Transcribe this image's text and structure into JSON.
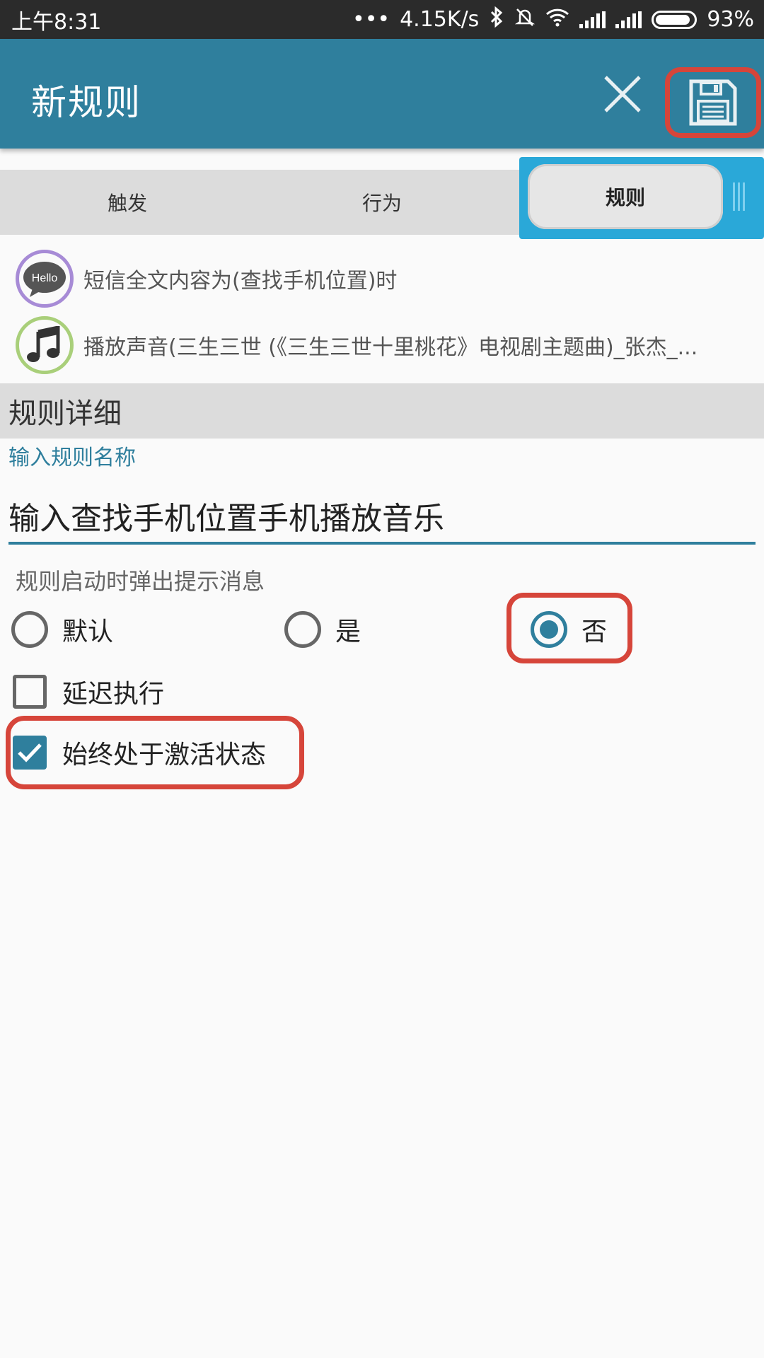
{
  "status_bar": {
    "time": "上午8:31",
    "dots": "•••",
    "speed": "4.15K/s",
    "battery": "93%",
    "bluetooth_icon": "bluetooth-icon",
    "mute_icon": "bell-off-icon",
    "wifi_icon": "wifi-icon"
  },
  "app_bar": {
    "title": "新规则",
    "close_icon": "close-icon",
    "save_icon": "floppy-save-icon"
  },
  "tabs": [
    {
      "label": "触发"
    },
    {
      "label": "行为"
    },
    {
      "label": "规则",
      "active": true
    }
  ],
  "summary": [
    {
      "icon": "hello-message-icon",
      "badge": "Hello",
      "text": "短信全文内容为(查找手机位置)时"
    },
    {
      "icon": "music-note-icon",
      "text": "播放声音(三生三世 (《三生三世十里桃花》电视剧主题曲)_张杰_..."
    }
  ],
  "details": {
    "section_title": "规则详细",
    "name_label": "输入规则名称",
    "name_value": "输入查找手机位置手机播放音乐",
    "prompt_label": "规则启动时弹出提示消息",
    "radio_options": [
      {
        "label": "默认",
        "checked": false
      },
      {
        "label": "是",
        "checked": false
      },
      {
        "label": "否",
        "checked": true
      }
    ],
    "checkboxes": [
      {
        "label": "延迟执行",
        "checked": false
      },
      {
        "label": "始终处于激活状态",
        "checked": true
      }
    ]
  },
  "colors": {
    "primary": "#2f7f9d",
    "accent_tab": "#2aa8d8",
    "highlight": "#d6453a",
    "status_bar": "#2b2b2b"
  }
}
